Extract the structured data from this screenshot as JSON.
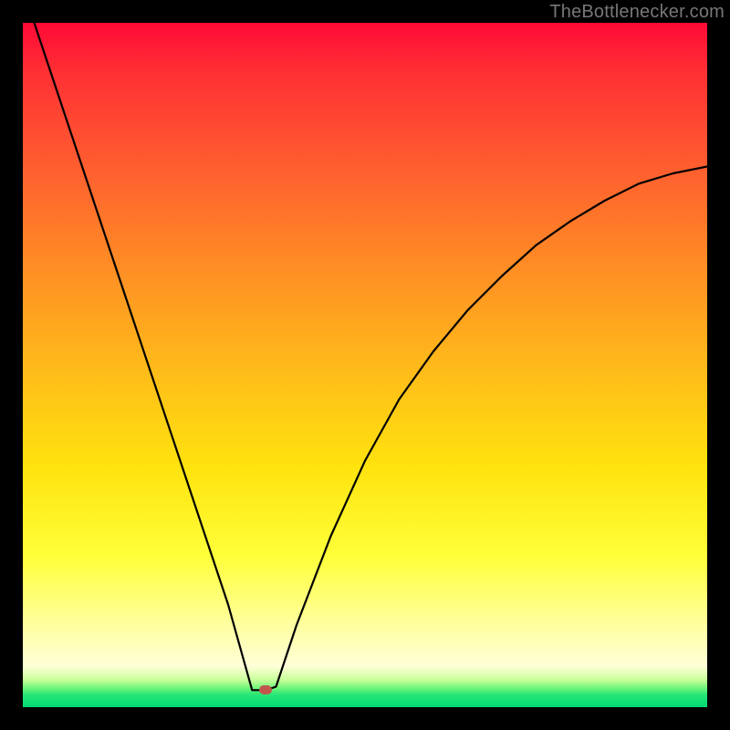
{
  "watermark": "TheBottlenecker.com",
  "chart_data": {
    "type": "line",
    "title": "",
    "xlabel": "",
    "ylabel": "",
    "xlim": [
      0,
      100
    ],
    "ylim": [
      0,
      100
    ],
    "series": [
      {
        "name": "bottleneck-curve",
        "x": [
          0,
          5,
          10,
          15,
          20,
          25,
          30,
          33.5,
          35.5,
          37,
          40,
          45,
          50,
          55,
          60,
          65,
          70,
          75,
          80,
          85,
          90,
          95,
          100
        ],
        "values": [
          105,
          90,
          75,
          60,
          45,
          30,
          15,
          2.5,
          2.5,
          3,
          12,
          25,
          36,
          45,
          52,
          58,
          63,
          67.5,
          71,
          74,
          76.5,
          78,
          79
        ]
      }
    ],
    "marker": {
      "x": 35.5,
      "y": 2.5,
      "color": "#c1574c"
    },
    "gradient_stops": [
      {
        "pos": 0,
        "color": "#ff0a36"
      },
      {
        "pos": 50,
        "color": "#ffe30e"
      },
      {
        "pos": 95,
        "color": "#ffffd8"
      },
      {
        "pos": 100,
        "color": "#00d974"
      }
    ]
  }
}
